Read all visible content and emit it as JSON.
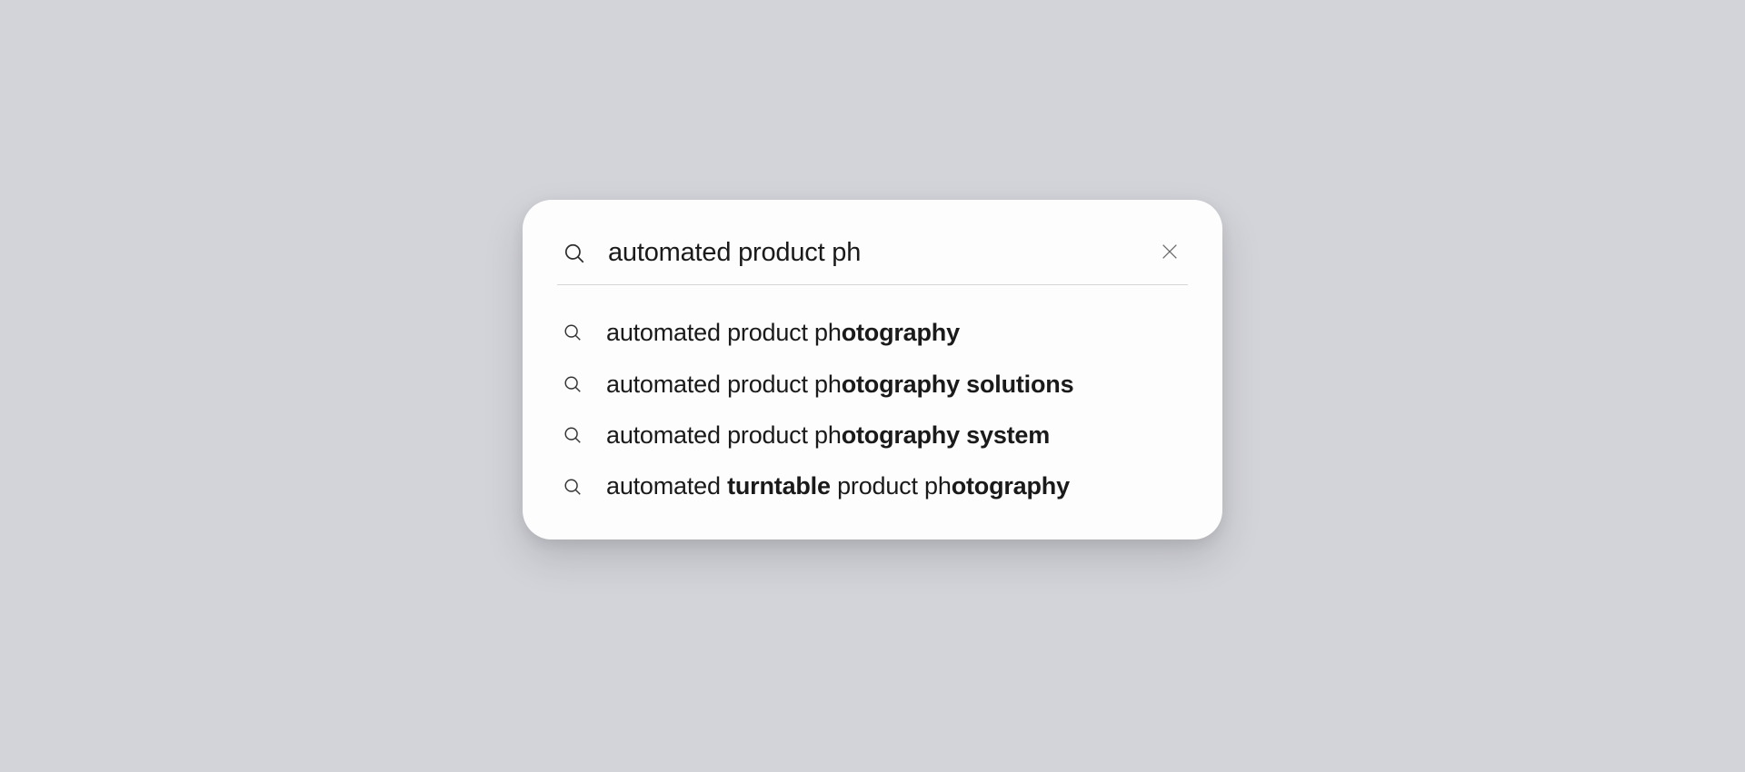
{
  "search": {
    "value": "automated product ph",
    "placeholder": ""
  },
  "suggestions": [
    {
      "segments": [
        {
          "text": "automated product ph",
          "bold": false
        },
        {
          "text": "otography",
          "bold": true
        }
      ]
    },
    {
      "segments": [
        {
          "text": "automated product ph",
          "bold": false
        },
        {
          "text": "otography solutions",
          "bold": true
        }
      ]
    },
    {
      "segments": [
        {
          "text": "automated product ph",
          "bold": false
        },
        {
          "text": "otography system",
          "bold": true
        }
      ]
    },
    {
      "segments": [
        {
          "text": "automated ",
          "bold": false
        },
        {
          "text": "turntable",
          "bold": true
        },
        {
          "text": " product ph",
          "bold": false
        },
        {
          "text": "otography",
          "bold": true
        }
      ]
    }
  ]
}
